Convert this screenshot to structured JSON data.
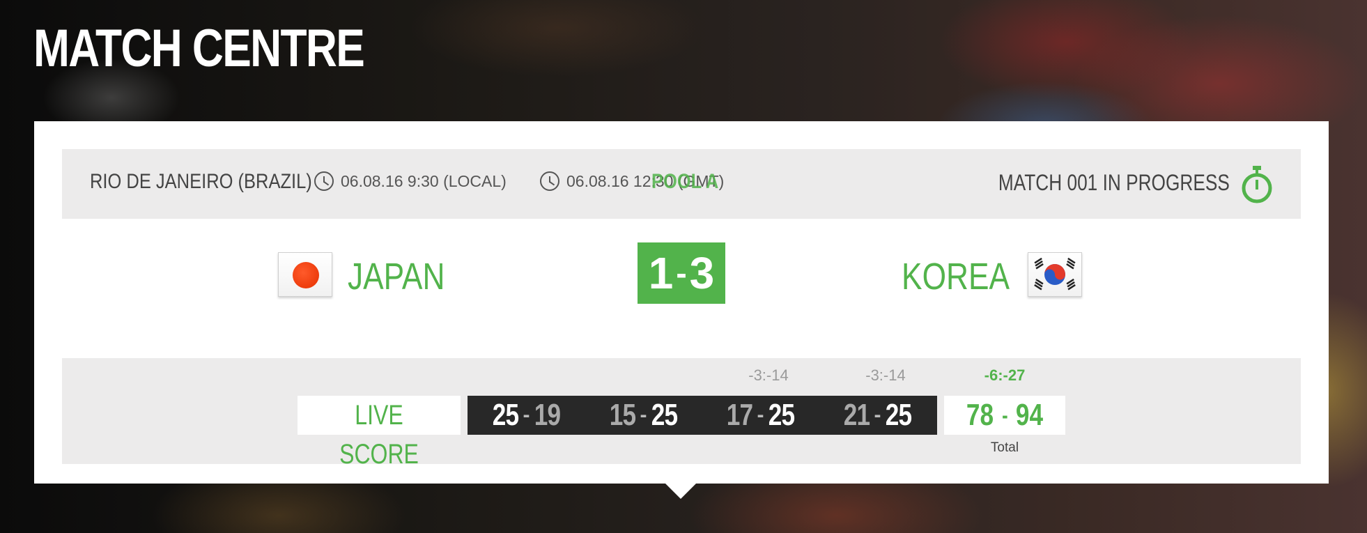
{
  "page": {
    "title": "MATCH CENTRE"
  },
  "match": {
    "location": "RIO DE JANEIRO (BRAZIL)",
    "local_time": "06.08.16 9:30 (LOCAL)",
    "gmt_time": "06.08.16 12:30 (GMT)",
    "pool": "POOL A",
    "status": "MATCH 001 IN PROGRESS",
    "home_team": "JAPAN",
    "away_team": "KOREA",
    "home_sets": "1",
    "away_sets": "3",
    "live_label": "LIVE SCORE",
    "sets": [
      {
        "home": "25",
        "away": "19",
        "diff": ""
      },
      {
        "home": "15",
        "away": "25",
        "diff": ""
      },
      {
        "home": "17",
        "away": "25",
        "diff": "-3:-14"
      },
      {
        "home": "21",
        "away": "25",
        "diff": "-3:-14"
      }
    ],
    "total": {
      "home": "78",
      "away": "94",
      "diff": "-6:-27",
      "label": "Total"
    }
  },
  "icons": {
    "time": "clock-icon",
    "status": "stopwatch-icon",
    "home_flag": "japan-flag",
    "away_flag": "korea-flag"
  },
  "colors": {
    "accent": "#52b34b",
    "panel": "#ffffff",
    "bar": "#ecebeb",
    "dark": "#282828"
  }
}
